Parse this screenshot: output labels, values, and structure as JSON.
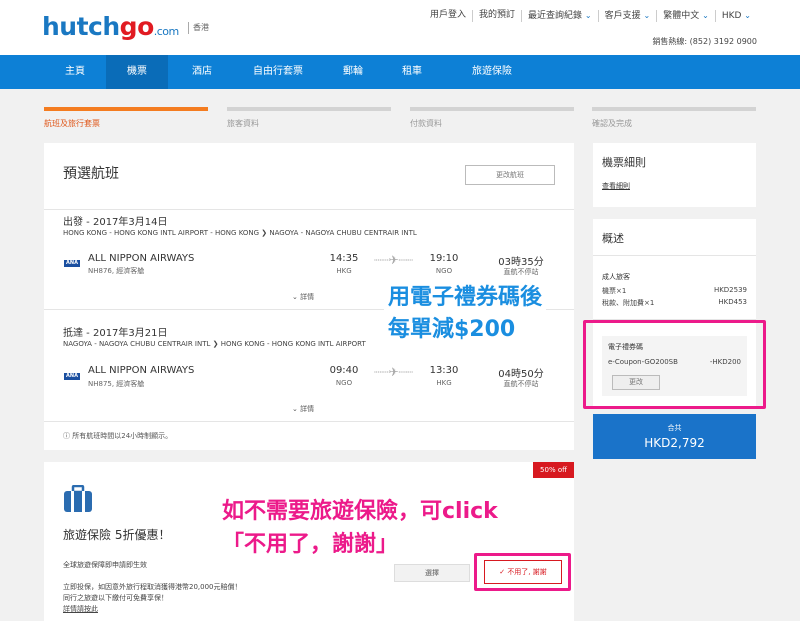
{
  "header": {
    "logo_main": "hutch",
    "logo_go": "go",
    "logo_com": ".com",
    "region": "香港",
    "nav": [
      "用戶登入",
      "我的預訂",
      "最近查詢紀錄",
      "客戶支援",
      "繁體中文",
      "HKD"
    ],
    "hotline": "銷售熱線: (852) 3192 0900"
  },
  "mainnav": {
    "items": [
      "主頁",
      "機票",
      "酒店",
      "自由行套票",
      "郵輪",
      "租車",
      "旅遊保險"
    ],
    "active_index": 1
  },
  "steps": [
    "航班及旅行套票",
    "旅客資料",
    "付款資料",
    "確認及完成"
  ],
  "flights": {
    "title": "預選航班",
    "change_button": "更改航班",
    "segments": [
      {
        "date": "出發 - 2017年3月14日",
        "route": "HONG KONG - HONG KONG INTL AIRPORT - HONG KONG ❯ NAGOYA - NAGOYA CHUBU CENTRAIR INTL",
        "airline": "ALL NIPPON AIRWAYS",
        "flight_no": "NH876, 經濟客艙",
        "dep_time": "14:35",
        "dep_code": "HKG",
        "arr_time": "19:10",
        "arr_code": "NGO",
        "duration": "03時35分",
        "direct": "直航不停站",
        "details": "詳情"
      },
      {
        "date": "抵達 - 2017年3月21日",
        "route": "NAGOYA - NAGOYA CHUBU CENTRAIR INTL ❯ HONG KONG - HONG KONG INTL AIRPORT",
        "airline": "ALL NIPPON AIRWAYS",
        "flight_no": "NH875, 經濟客艙",
        "dep_time": "09:40",
        "dep_code": "NGO",
        "arr_time": "13:30",
        "arr_code": "HKG",
        "duration": "04時50分",
        "direct": "直航不停站",
        "details": "詳情"
      }
    ],
    "notice": "所有航班時間以24小時制顯示。"
  },
  "insurance": {
    "badge": "50% off",
    "title": "旅遊保險 5折優惠！",
    "lines": [
      "全球旅遊保障即申請即生效",
      "立即投保，如因意外旅行程取消獲得港幣20,000元賠償！",
      "同行之旅遊以下繳付可免費享保！",
      "詳情請按此"
    ],
    "select_button": "選擇",
    "decline_button": "不用了, 謝謝"
  },
  "rules": {
    "title": "機票細則",
    "link": "查看細則"
  },
  "summary": {
    "title": "概述",
    "passenger_label": "成人旅客",
    "rows": [
      {
        "label": "機票×1",
        "value": "HKD2539"
      },
      {
        "label": "稅款、附加費×1",
        "value": "HKD453"
      }
    ],
    "coupon_title": "電子禮券碼",
    "coupon_code": "e-Coupon-GO200SB",
    "coupon_value": "-HKD200",
    "coupon_change": "更改"
  },
  "total": {
    "label": "合共",
    "amount": "HKD2,792"
  },
  "annotations": {
    "coupon_line1": "用電子禮券碼後",
    "coupon_line2": "每單減$200",
    "ins_line1": "如不需要旅遊保險，可click",
    "ins_line2": "「不用了，謝謝」"
  },
  "colors": {
    "brand_blue": "#0d80d6",
    "brand_red": "#e11b22",
    "accent_orange": "#f47c20",
    "highlight_pink": "#ec1a8a"
  }
}
